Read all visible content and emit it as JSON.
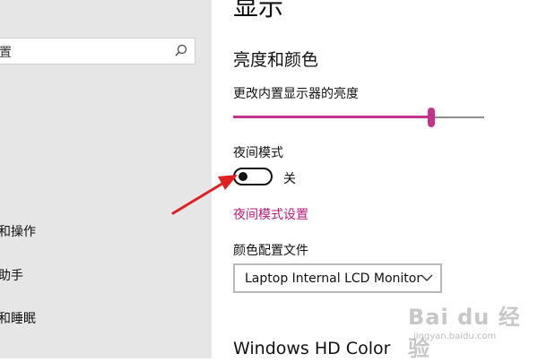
{
  "sidebar": {
    "search_partial": "置",
    "items": [
      {
        "label": "和操作"
      },
      {
        "label": "助手"
      },
      {
        "label": "和睡眠"
      }
    ]
  },
  "main": {
    "title": "显示",
    "section_title": "亮度和颜色",
    "brightness_label": "更改内置显示器的亮度",
    "brightness_value": 0.79,
    "night_mode_label": "夜间模式",
    "night_mode_state": "关",
    "night_mode_settings_link": "夜间模式设置",
    "color_profile_label": "颜色配置文件",
    "color_profile_value": "Laptop Internal LCD Monitor",
    "hd_color_title": "Windows HD Color"
  },
  "watermark": {
    "brand": "Bai du 经验",
    "url": "jingyan.baidu.com"
  },
  "colors": {
    "accent": "#c3358d",
    "link": "#b5197b",
    "arrow": "#e02020",
    "sidebar_bg": "#e6e6e6"
  }
}
